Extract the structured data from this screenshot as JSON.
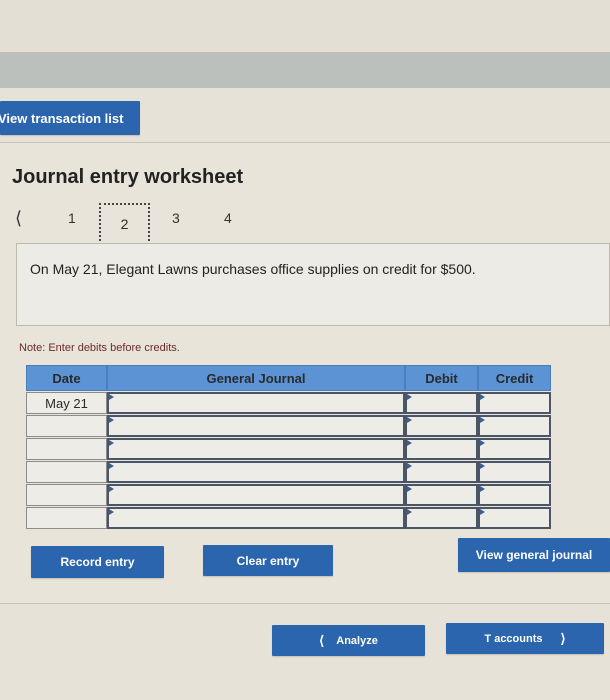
{
  "toolbar": {
    "view_transaction_list_label": "View transaction list"
  },
  "worksheet": {
    "title": "Journal entry worksheet",
    "pager": {
      "prev_icon": "chevron-left",
      "pages": [
        "1",
        "2",
        "3",
        "4"
      ],
      "active_page": "2"
    },
    "question": "On May 21, Elegant Lawns purchases office supplies on credit for $500.",
    "note": "Note: Enter debits before credits.",
    "table": {
      "headers": {
        "date": "Date",
        "general_journal": "General Journal",
        "debit": "Debit",
        "credit": "Credit"
      },
      "rows": [
        {
          "date": "May 21",
          "account": "",
          "debit": "",
          "credit": ""
        },
        {
          "date": "",
          "account": "",
          "debit": "",
          "credit": ""
        },
        {
          "date": "",
          "account": "",
          "debit": "",
          "credit": ""
        },
        {
          "date": "",
          "account": "",
          "debit": "",
          "credit": ""
        },
        {
          "date": "",
          "account": "",
          "debit": "",
          "credit": ""
        },
        {
          "date": "",
          "account": "",
          "debit": "",
          "credit": ""
        }
      ]
    },
    "buttons": {
      "record": "Record entry",
      "clear": "Clear entry",
      "view_journal": "View general journal"
    }
  },
  "navigation": {
    "analyze_label": "Analyze",
    "analyze_icon": "chevron-left",
    "t_accounts_label": "T accounts",
    "t_accounts_icon": "chevron-right"
  },
  "colors": {
    "button_blue": "#2a65ad",
    "header_blue": "#5b93d4",
    "note_red": "#6a2a2a"
  }
}
